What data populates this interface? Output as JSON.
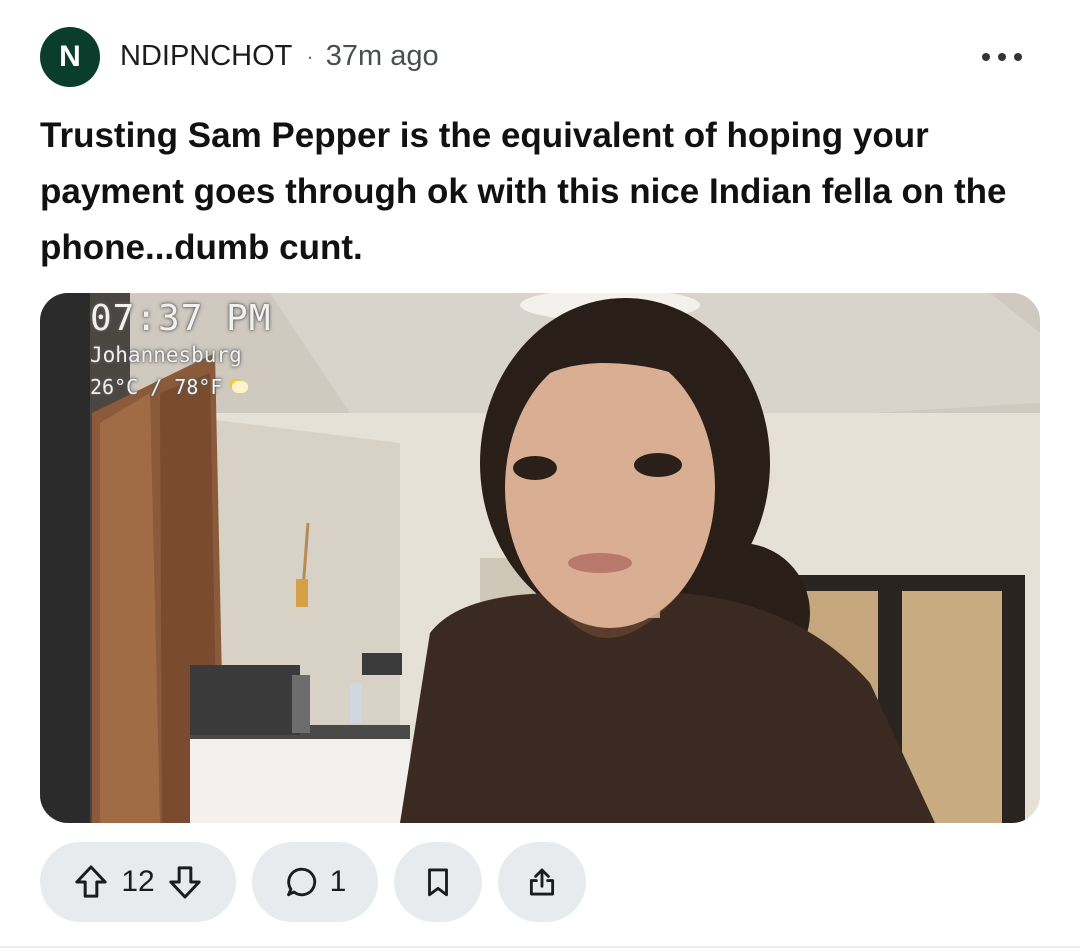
{
  "post": {
    "author_initial": "N",
    "author": "NDIPNCHOT",
    "separator": "·",
    "time": "37m ago",
    "title": "Trusting Sam Pepper is the equivalent of hoping your payment goes through ok with this nice Indian fella on the phone...dumb cunt."
  },
  "media": {
    "overlay_time": "07:37 PM",
    "overlay_city": "Johannesburg",
    "overlay_temp": "26°C / 78°F",
    "weather_icon": "partly-cloudy-icon"
  },
  "actions": {
    "upvote_icon": "upvote-arrow-icon",
    "votes": "12",
    "downvote_icon": "downvote-arrow-icon",
    "comment_icon": "comment-bubble-icon",
    "comments": "1",
    "save_icon": "bookmark-icon",
    "share_icon": "share-icon"
  },
  "colors": {
    "avatar_bg": "#0b3d2c",
    "pill_bg": "#e8ebed"
  }
}
